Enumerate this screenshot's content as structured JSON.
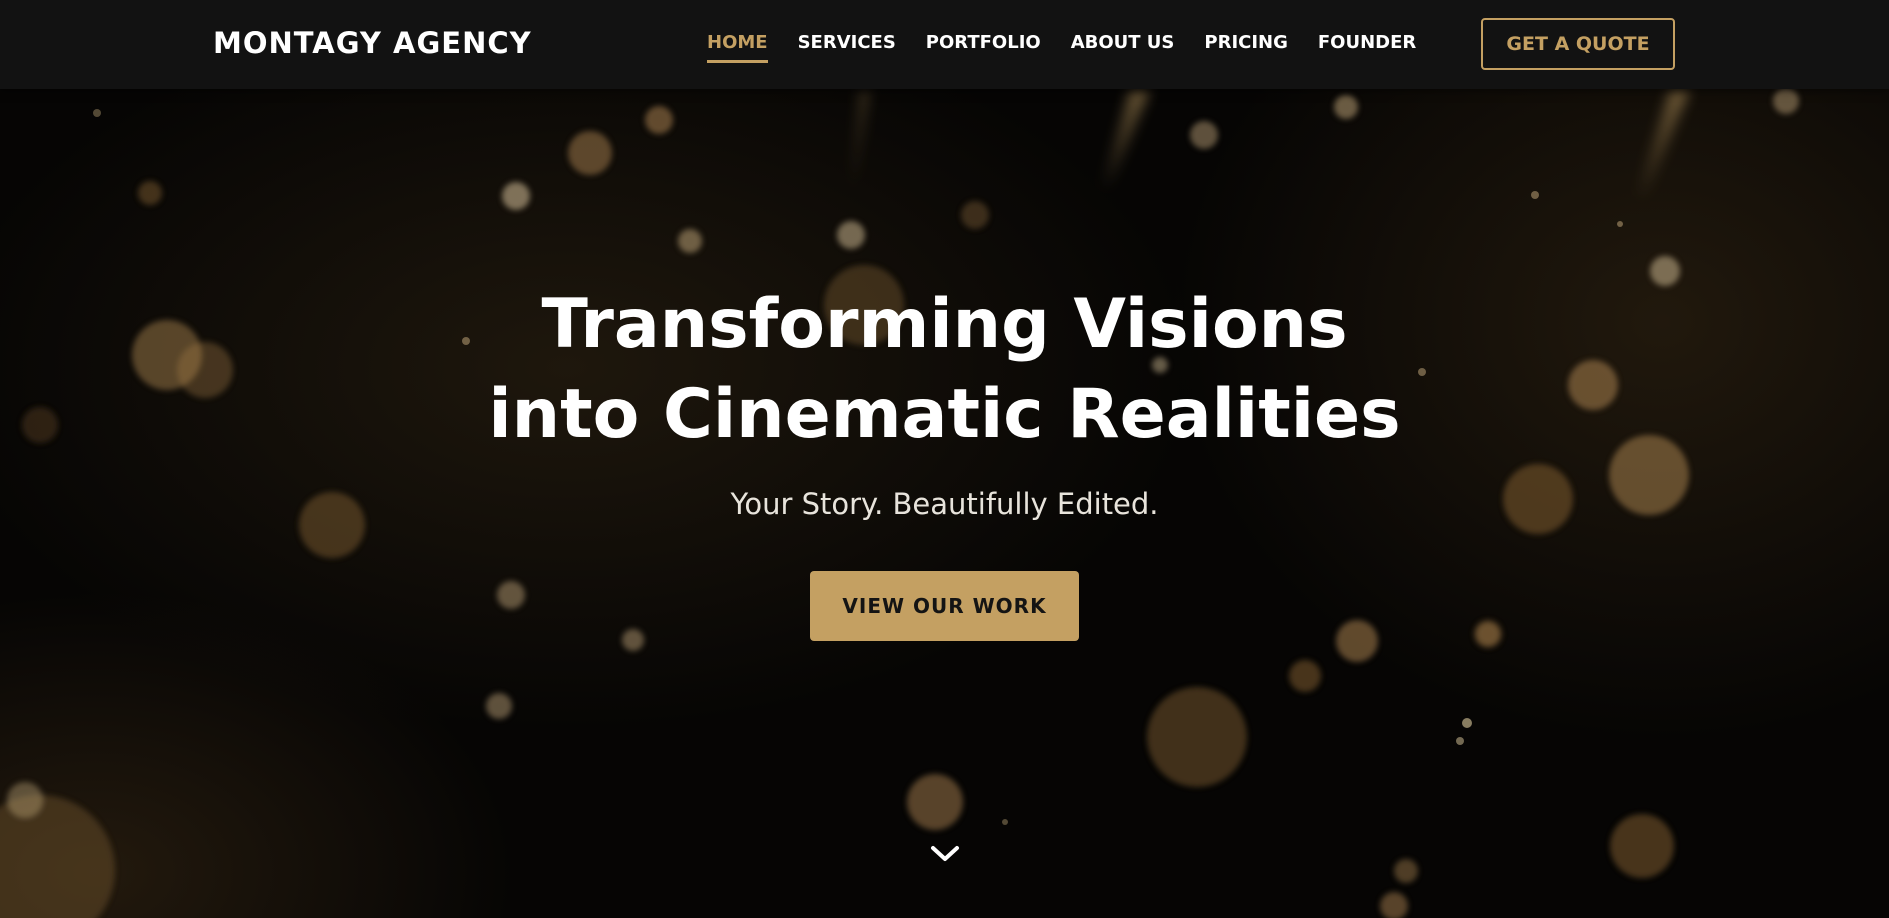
{
  "brand": {
    "name": "MONTAGY AGENCY",
    "accent_color": "#c4a062",
    "nav_bg_color": "#121212"
  },
  "nav": {
    "items": [
      {
        "label": "HOME",
        "active": true
      },
      {
        "label": "SERVICES",
        "active": false
      },
      {
        "label": "PORTFOLIO",
        "active": false
      },
      {
        "label": "ABOUT US",
        "active": false
      },
      {
        "label": "PRICING",
        "active": false
      },
      {
        "label": "FOUNDER",
        "active": false
      }
    ],
    "quote_button": "GET A QUOTE"
  },
  "hero": {
    "title_line1": "Transforming Visions",
    "title_line2": "into Cinematic Realities",
    "subtitle": "Your Story. Beautifully Edited.",
    "cta_label": "VIEW OUR WORK",
    "scroll_icon": "chevron-down-icon"
  }
}
